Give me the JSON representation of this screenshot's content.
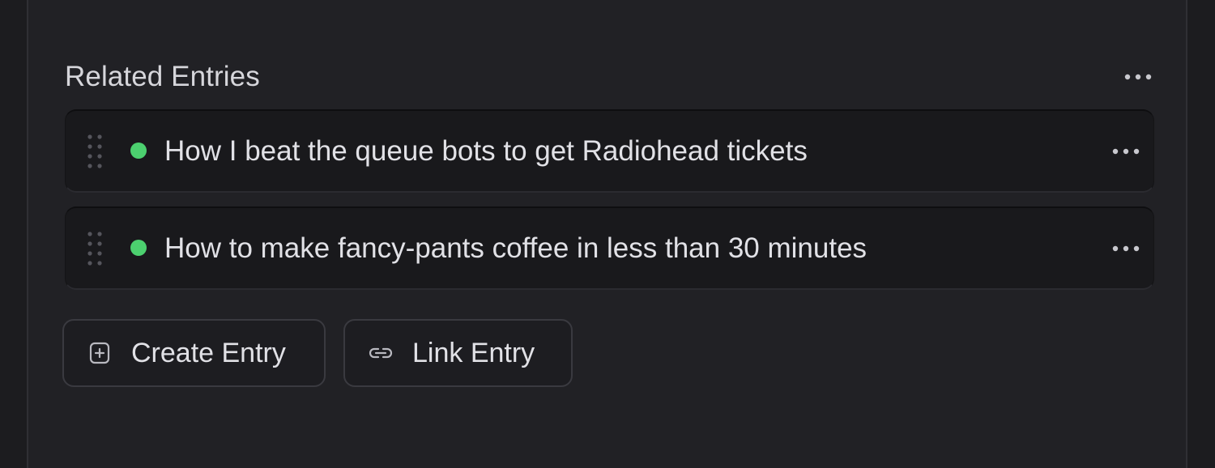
{
  "section": {
    "title": "Related Entries",
    "more_icon": "ellipsis-icon"
  },
  "entries": [
    {
      "title": "How I beat the queue bots to get Radiohead tickets",
      "status_color": "#4cd06f",
      "drag_icon": "drag-handle-icon",
      "more_icon": "ellipsis-icon"
    },
    {
      "title": "How to make fancy-pants coffee in less than 30 minutes",
      "status_color": "#4cd06f",
      "drag_icon": "drag-handle-icon",
      "more_icon": "ellipsis-icon"
    }
  ],
  "actions": {
    "create_label": "Create Entry",
    "create_icon": "plus-square-icon",
    "link_label": "Link Entry",
    "link_icon": "link-icon"
  },
  "colors": {
    "background": "#1c1c1f",
    "panel": "#212125",
    "card": "#19191c",
    "text": "#e1e1e6",
    "status_green": "#4cd06f"
  }
}
